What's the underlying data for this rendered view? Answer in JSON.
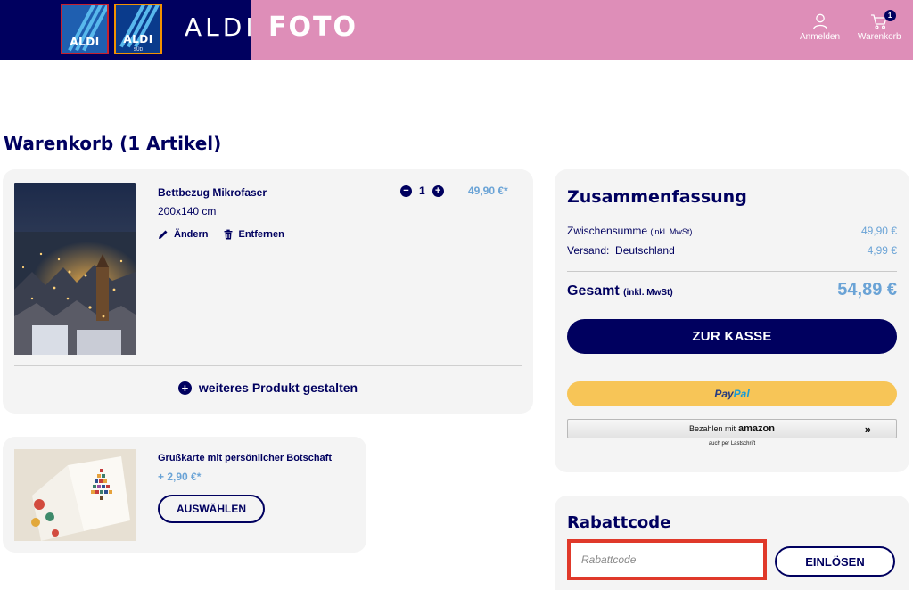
{
  "header": {
    "logo1_text": "ALDI",
    "logo2_text": "ALDI",
    "logo2_sub": "SÜD",
    "brand": "ALDI",
    "section": "FOTO",
    "login_label": "Anmelden",
    "cart_label": "Warenkorb",
    "cart_count": "1"
  },
  "page": {
    "title": "Warenkorb (1 Artikel)"
  },
  "product": {
    "name": "Bettbezug Mikrofaser",
    "size": "200x140 cm",
    "edit_label": "Ändern",
    "remove_label": "Entfernen",
    "quantity": "1",
    "price": "49,90 €*",
    "add_more_label": "weiteres Produkt gestalten"
  },
  "greeting_card": {
    "title": "Grußkarte mit persönlicher Botschaft",
    "price": "+ 2,90 €*",
    "select_label": "AUSWÄHLEN"
  },
  "summary": {
    "title": "Zusammenfassung",
    "subtotal_label": "Zwischensumme",
    "subtotal_note": "(inkl. MwSt)",
    "subtotal_value": "49,90 €",
    "shipping_label": "Versand:  Deutschland",
    "shipping_value": "4,99 €",
    "total_label": "Gesamt",
    "total_note": "(inkl. MwSt)",
    "total_value": "54,89 €",
    "checkout_label": "ZUR KASSE",
    "paypal_part1": "Pay",
    "paypal_part2": "Pal",
    "amazon_prefix": "Bezahlen mit",
    "amazon_brand": "amazon",
    "amazon_arrows": "»",
    "amazon_note": "auch per Lastschrift"
  },
  "coupon": {
    "title": "Rabattcode",
    "placeholder": "Rabattcode",
    "value": "",
    "redeem_label": "EINLÖSEN"
  },
  "colors": {
    "navy": "#00005f",
    "pink": "#de8eb8",
    "price_blue": "#6aa3d6",
    "paypal_yellow": "#f7c557",
    "highlight_red": "#e0392a",
    "card_bg": "#f4f4f4"
  }
}
